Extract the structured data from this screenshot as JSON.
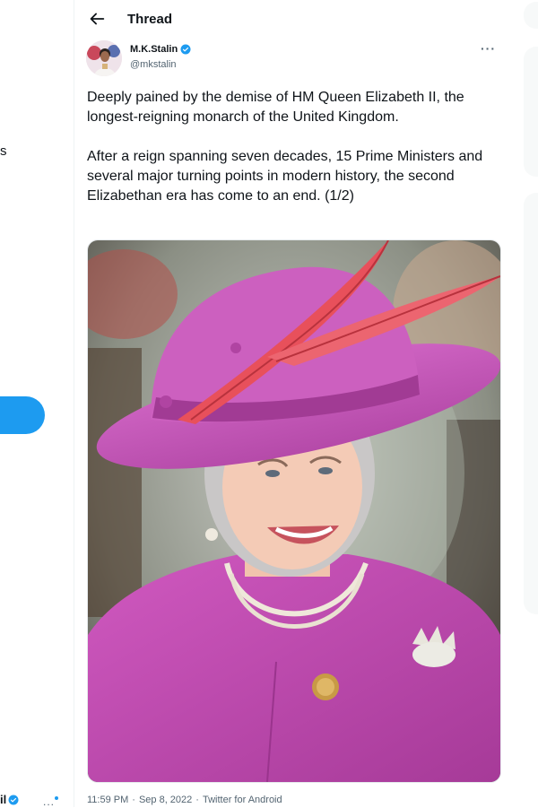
{
  "left_nav": {
    "partial_label": "s",
    "bottom_account_fragment": "il",
    "bottom_more": "..."
  },
  "header": {
    "back_label": "←",
    "title": "Thread"
  },
  "tweet": {
    "author_name": "M.K.Stalin",
    "author_handle": "@mkstalin",
    "more_label": "···",
    "paragraphs": [
      "Deeply pained by the demise of HM Queen Elizabeth II, the longest-reigning monarch of the United Kingdom.",
      "After a reign spanning seven decades, 15 Prime Ministers and several major turning points in modern history, the second Elizabethan era has come to an end. (1/2)"
    ],
    "time": "11:59 PM",
    "separator": "·",
    "date": "Sep 8, 2022",
    "source": "Twitter for Android"
  },
  "colors": {
    "accent": "#1d9bf0",
    "text": "#0f1419",
    "muted": "#536471",
    "coat": "#c043b3",
    "feather": "#e8505b"
  }
}
